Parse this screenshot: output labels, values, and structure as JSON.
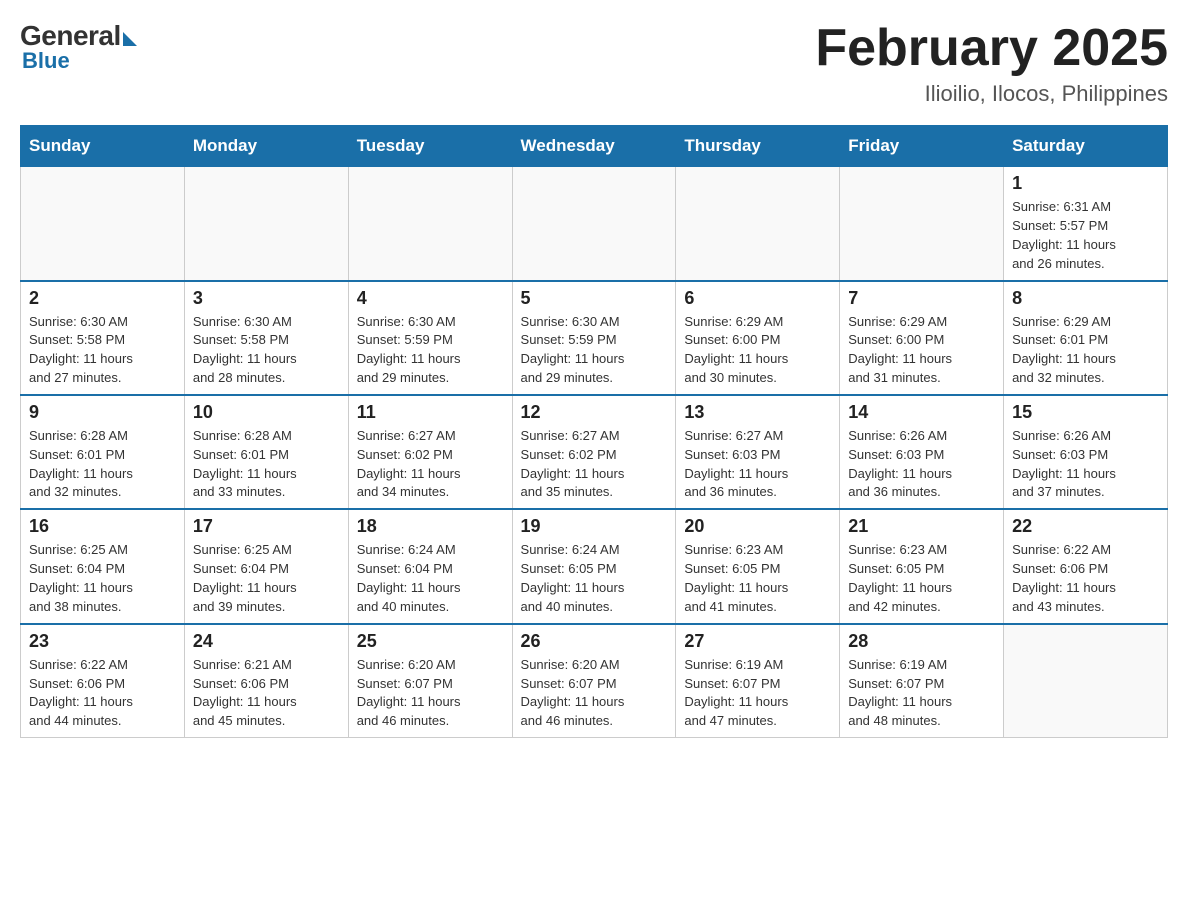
{
  "header": {
    "logo": {
      "general": "General",
      "blue": "Blue"
    },
    "title": "February 2025",
    "location": "Ilioilio, Ilocos, Philippines"
  },
  "days_of_week": [
    "Sunday",
    "Monday",
    "Tuesday",
    "Wednesday",
    "Thursday",
    "Friday",
    "Saturday"
  ],
  "weeks": [
    {
      "days": [
        {
          "num": "",
          "info": ""
        },
        {
          "num": "",
          "info": ""
        },
        {
          "num": "",
          "info": ""
        },
        {
          "num": "",
          "info": ""
        },
        {
          "num": "",
          "info": ""
        },
        {
          "num": "",
          "info": ""
        },
        {
          "num": "1",
          "info": "Sunrise: 6:31 AM\nSunset: 5:57 PM\nDaylight: 11 hours\nand 26 minutes."
        }
      ]
    },
    {
      "days": [
        {
          "num": "2",
          "info": "Sunrise: 6:30 AM\nSunset: 5:58 PM\nDaylight: 11 hours\nand 27 minutes."
        },
        {
          "num": "3",
          "info": "Sunrise: 6:30 AM\nSunset: 5:58 PM\nDaylight: 11 hours\nand 28 minutes."
        },
        {
          "num": "4",
          "info": "Sunrise: 6:30 AM\nSunset: 5:59 PM\nDaylight: 11 hours\nand 29 minutes."
        },
        {
          "num": "5",
          "info": "Sunrise: 6:30 AM\nSunset: 5:59 PM\nDaylight: 11 hours\nand 29 minutes."
        },
        {
          "num": "6",
          "info": "Sunrise: 6:29 AM\nSunset: 6:00 PM\nDaylight: 11 hours\nand 30 minutes."
        },
        {
          "num": "7",
          "info": "Sunrise: 6:29 AM\nSunset: 6:00 PM\nDaylight: 11 hours\nand 31 minutes."
        },
        {
          "num": "8",
          "info": "Sunrise: 6:29 AM\nSunset: 6:01 PM\nDaylight: 11 hours\nand 32 minutes."
        }
      ]
    },
    {
      "days": [
        {
          "num": "9",
          "info": "Sunrise: 6:28 AM\nSunset: 6:01 PM\nDaylight: 11 hours\nand 32 minutes."
        },
        {
          "num": "10",
          "info": "Sunrise: 6:28 AM\nSunset: 6:01 PM\nDaylight: 11 hours\nand 33 minutes."
        },
        {
          "num": "11",
          "info": "Sunrise: 6:27 AM\nSunset: 6:02 PM\nDaylight: 11 hours\nand 34 minutes."
        },
        {
          "num": "12",
          "info": "Sunrise: 6:27 AM\nSunset: 6:02 PM\nDaylight: 11 hours\nand 35 minutes."
        },
        {
          "num": "13",
          "info": "Sunrise: 6:27 AM\nSunset: 6:03 PM\nDaylight: 11 hours\nand 36 minutes."
        },
        {
          "num": "14",
          "info": "Sunrise: 6:26 AM\nSunset: 6:03 PM\nDaylight: 11 hours\nand 36 minutes."
        },
        {
          "num": "15",
          "info": "Sunrise: 6:26 AM\nSunset: 6:03 PM\nDaylight: 11 hours\nand 37 minutes."
        }
      ]
    },
    {
      "days": [
        {
          "num": "16",
          "info": "Sunrise: 6:25 AM\nSunset: 6:04 PM\nDaylight: 11 hours\nand 38 minutes."
        },
        {
          "num": "17",
          "info": "Sunrise: 6:25 AM\nSunset: 6:04 PM\nDaylight: 11 hours\nand 39 minutes."
        },
        {
          "num": "18",
          "info": "Sunrise: 6:24 AM\nSunset: 6:04 PM\nDaylight: 11 hours\nand 40 minutes."
        },
        {
          "num": "19",
          "info": "Sunrise: 6:24 AM\nSunset: 6:05 PM\nDaylight: 11 hours\nand 40 minutes."
        },
        {
          "num": "20",
          "info": "Sunrise: 6:23 AM\nSunset: 6:05 PM\nDaylight: 11 hours\nand 41 minutes."
        },
        {
          "num": "21",
          "info": "Sunrise: 6:23 AM\nSunset: 6:05 PM\nDaylight: 11 hours\nand 42 minutes."
        },
        {
          "num": "22",
          "info": "Sunrise: 6:22 AM\nSunset: 6:06 PM\nDaylight: 11 hours\nand 43 minutes."
        }
      ]
    },
    {
      "days": [
        {
          "num": "23",
          "info": "Sunrise: 6:22 AM\nSunset: 6:06 PM\nDaylight: 11 hours\nand 44 minutes."
        },
        {
          "num": "24",
          "info": "Sunrise: 6:21 AM\nSunset: 6:06 PM\nDaylight: 11 hours\nand 45 minutes."
        },
        {
          "num": "25",
          "info": "Sunrise: 6:20 AM\nSunset: 6:07 PM\nDaylight: 11 hours\nand 46 minutes."
        },
        {
          "num": "26",
          "info": "Sunrise: 6:20 AM\nSunset: 6:07 PM\nDaylight: 11 hours\nand 46 minutes."
        },
        {
          "num": "27",
          "info": "Sunrise: 6:19 AM\nSunset: 6:07 PM\nDaylight: 11 hours\nand 47 minutes."
        },
        {
          "num": "28",
          "info": "Sunrise: 6:19 AM\nSunset: 6:07 PM\nDaylight: 11 hours\nand 48 minutes."
        },
        {
          "num": "",
          "info": ""
        }
      ]
    }
  ]
}
